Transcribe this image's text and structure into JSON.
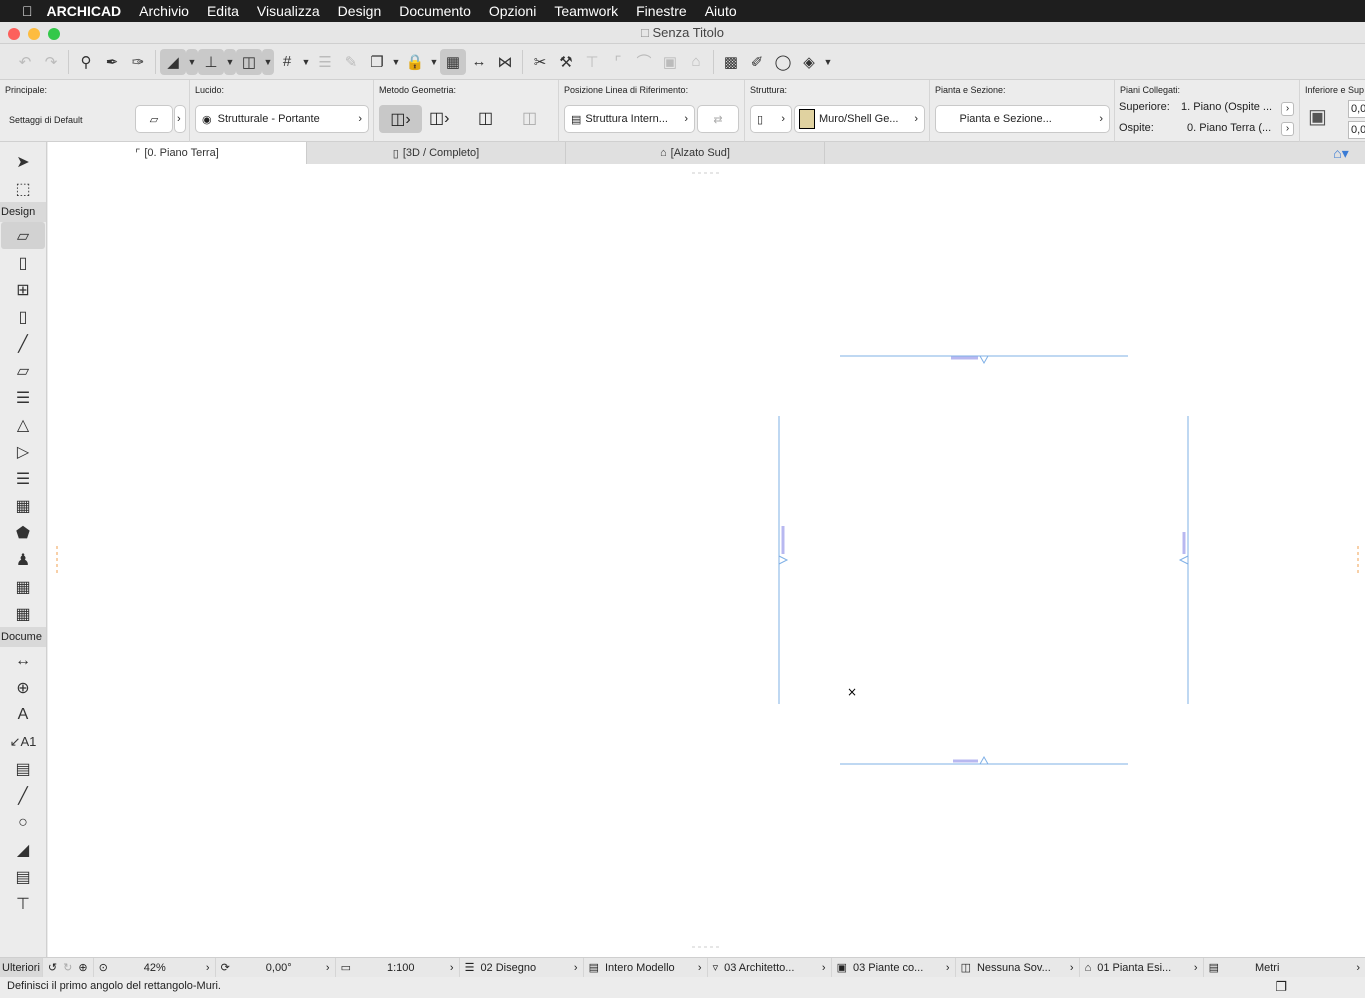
{
  "menubar": {
    "app": "ARCHICAD",
    "items": [
      "Archivio",
      "Edita",
      "Visualizza",
      "Design",
      "Documento",
      "Opzioni",
      "Teamwork",
      "Finestre",
      "Aiuto"
    ]
  },
  "window": {
    "title": "Senza Titolo"
  },
  "infobox": {
    "principale": {
      "label": "Principale:",
      "value": "Settaggi di Default"
    },
    "lucido": {
      "label": "Lucido:",
      "value": "Strutturale - Portante"
    },
    "metodo": {
      "label": "Metodo Geometria:"
    },
    "posizione": {
      "label": "Posizione Linea di Riferimento:",
      "value": "Struttura Intern..."
    },
    "struttura": {
      "label": "Struttura:",
      "value": "Muro/Shell Ge..."
    },
    "pianta": {
      "label": "Pianta e Sezione:",
      "value": "Pianta e Sezione..."
    },
    "piani": {
      "label": "Piani Collegati:",
      "superiore_label": "Superiore:",
      "superiore_value": "1. Piano (Ospite ...",
      "ospite_label": "Ospite:",
      "ospite_value": "0. Piano Terra (..."
    },
    "inferiore": {
      "label": "Inferiore e Sup",
      "top_value": "0,0",
      "bottom_value": "0,0"
    }
  },
  "tabs": [
    {
      "label": "[0. Piano Terra]",
      "active": true
    },
    {
      "label": "[3D / Completo]"
    },
    {
      "label": "[Alzato Sud]"
    }
  ],
  "toolbox": {
    "sections": [
      "Design",
      "Docume"
    ]
  },
  "status": {
    "more": "Ulteriori",
    "zoom": "42%",
    "angle": "0,00°",
    "scale": "1:100",
    "pen_set": "02 Disegno",
    "model": "Intero Modello",
    "layer": "03 Architetto...",
    "view": "03 Piante co...",
    "override": "Nessuna Sov...",
    "reno": "01 Pianta Esi...",
    "units": "Metri"
  },
  "message": "Definisci il primo angolo del rettangolo-Muri.",
  "colors": {
    "accent": "#7fb0e6",
    "selection": "#b8b8f0"
  }
}
